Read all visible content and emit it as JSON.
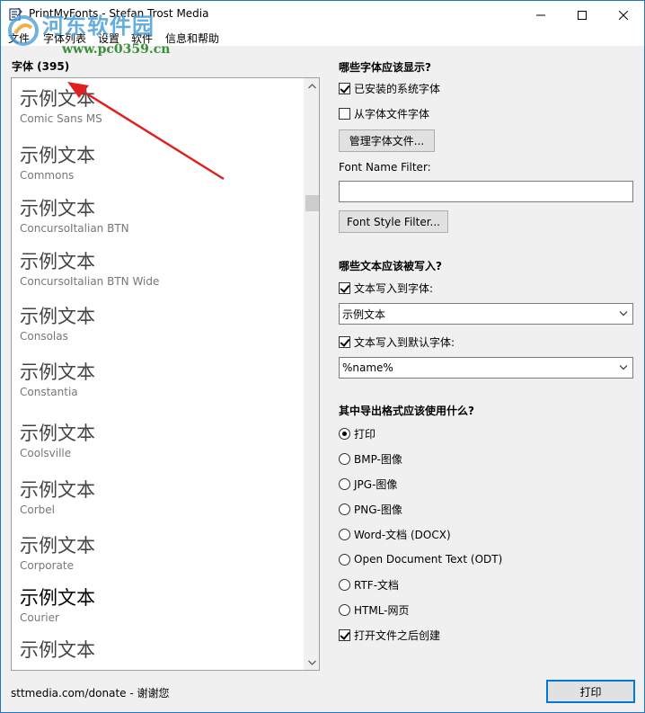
{
  "window": {
    "title": "PrintMyFonts - Stefan Trost Media"
  },
  "menu": {
    "items": [
      "文件",
      "字体列表",
      "设置",
      "软件",
      "信息和帮助"
    ]
  },
  "watermark": {
    "site_name": "河东软件园",
    "url": "www.pc0359.cn"
  },
  "font_list": {
    "heading": "字体 (395)",
    "items": [
      {
        "sample": "示例文本",
        "name": "Comic Sans MS"
      },
      {
        "sample": "示例文本",
        "name": "Commons"
      },
      {
        "sample": "示例文本",
        "name": "ConcursoItalian BTN"
      },
      {
        "sample": "示例文本",
        "name": "ConcursoItalian BTN Wide"
      },
      {
        "sample": "示例文本",
        "name": "Consolas"
      },
      {
        "sample": "示例文本",
        "name": "Constantia"
      },
      {
        "sample": "示例文本",
        "name": "Coolsville"
      },
      {
        "sample": "示例文本",
        "name": "Corbel"
      },
      {
        "sample": "示例文本",
        "name": "Corporate"
      },
      {
        "sample": "示例文本",
        "name": "Courier"
      },
      {
        "sample": "示例文本",
        "name": ""
      }
    ]
  },
  "display_section": {
    "heading": "哪些字体应该显示?",
    "installed_label": "已安装的系统字体",
    "installed_checked": true,
    "from_files_label": "从字体文件字体",
    "from_files_checked": false,
    "manage_button": "管理字体文件...",
    "name_filter_label": "Font Name Filter:",
    "name_filter_value": "",
    "style_filter_button": "Font Style Filter..."
  },
  "text_section": {
    "heading": "哪些文本应该被写入?",
    "write_to_font_label": "文本写入到字体:",
    "write_to_font_checked": true,
    "write_to_font_value": "示例文本",
    "write_to_default_label": "文本写入到默认字体:",
    "write_to_default_checked": true,
    "write_to_default_value": "%name%"
  },
  "export_section": {
    "heading": "其中导出格式应该使用什么?",
    "options": [
      {
        "label": "打印",
        "selected": true
      },
      {
        "label": "BMP-图像",
        "selected": false
      },
      {
        "label": "JPG-图像",
        "selected": false
      },
      {
        "label": "PNG-图像",
        "selected": false
      },
      {
        "label": "Word-文档 (DOCX)",
        "selected": false
      },
      {
        "label": "Open Document Text (ODT)",
        "selected": false
      },
      {
        "label": "RTF-文档",
        "selected": false
      },
      {
        "label": "HTML-网页",
        "selected": false
      }
    ],
    "open_after_label": "打开文件之后创建",
    "open_after_checked": true
  },
  "footer": {
    "donate_text": "sttmedia.com/donate - 谢谢您",
    "print_button": "打印"
  },
  "colors": {
    "window_border": "#1e78c8",
    "accent": "#0078d7",
    "annotation_arrow": "#e02020"
  }
}
